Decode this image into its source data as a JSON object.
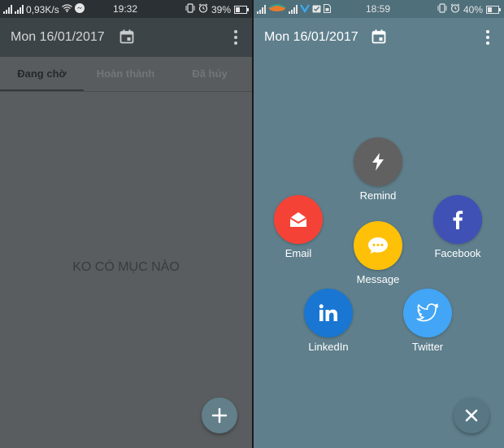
{
  "left": {
    "status": {
      "speed": "0,93K/s",
      "time": "19:32",
      "battery": "39%",
      "battery_level": 0.39
    },
    "toolbar": {
      "title": "Mon 16/01/2017"
    },
    "tabs": [
      "Đang chờ",
      "Hoàn thành",
      "Đã hủy"
    ],
    "empty_text": "KO CÓ MỤC NÀO",
    "fab_icon": "plus-icon"
  },
  "right": {
    "status": {
      "time": "18:59",
      "battery": "40%",
      "battery_level": 0.4
    },
    "toolbar": {
      "title": "Mon 16/01/2017"
    },
    "share_items": [
      {
        "label": "Remind",
        "icon": "flash-icon",
        "color": "#616161"
      },
      {
        "label": "Email",
        "icon": "email-icon",
        "color": "#f44336"
      },
      {
        "label": "Facebook",
        "icon": "facebook-icon",
        "color": "#3f51b5"
      },
      {
        "label": "Message",
        "icon": "message-icon",
        "color": "#ffc107"
      },
      {
        "label": "LinkedIn",
        "icon": "linkedin-icon",
        "color": "#1976d2"
      },
      {
        "label": "Twitter",
        "icon": "twitter-icon",
        "color": "#42a5f5"
      }
    ],
    "fab_icon": "close-icon"
  }
}
